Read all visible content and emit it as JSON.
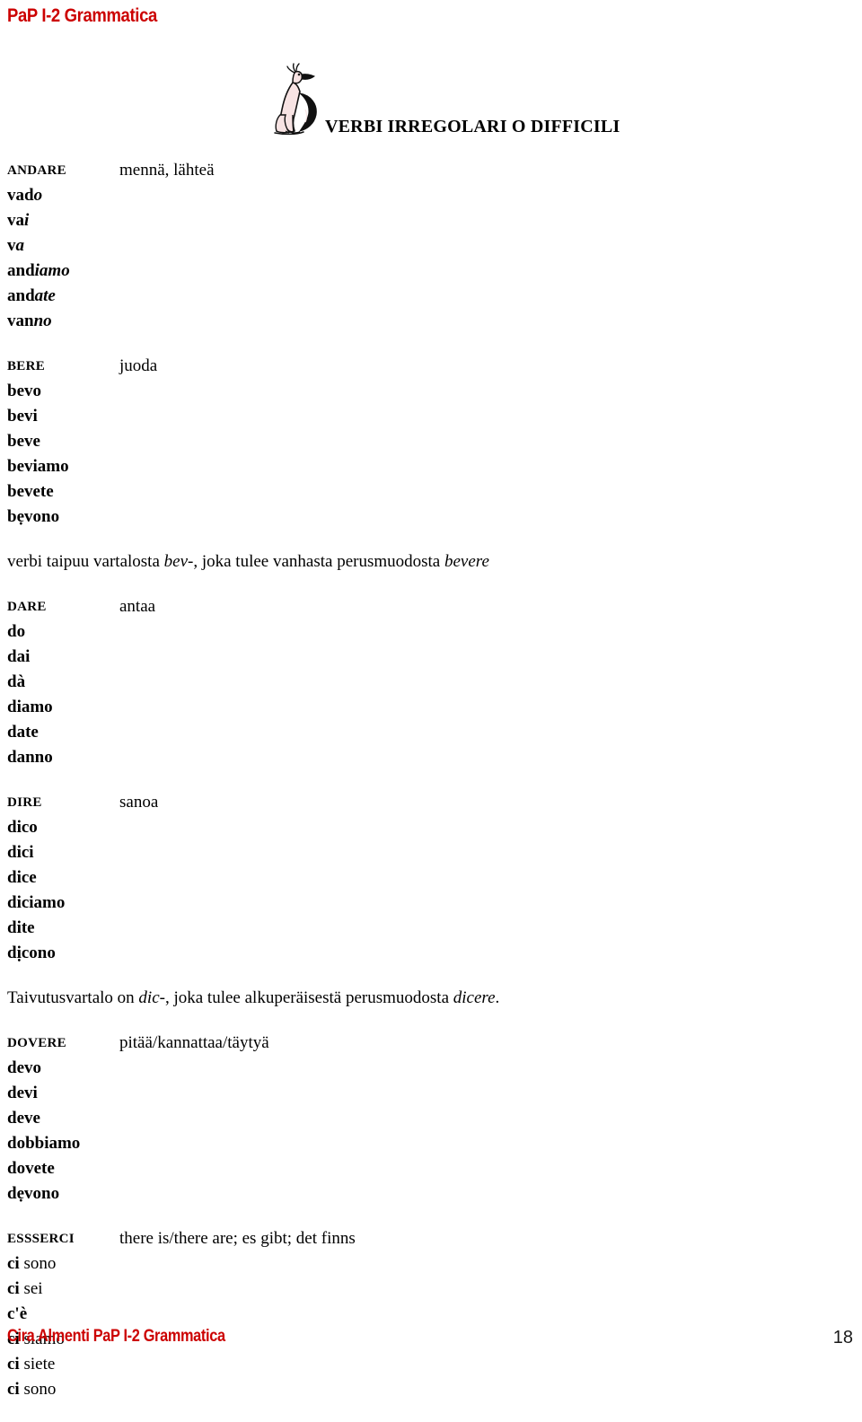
{
  "header": {
    "title": "PaP I-2 Grammatica",
    "title_color": "#CC0000"
  },
  "section": {
    "heading": "VERBI IRREGOLARI O DIFFICILI",
    "mascot_name": "sitting-dog-mascot",
    "mascot_body_color": "#F7E3E3",
    "mascot_outline_color": "#000000"
  },
  "verbs": [
    {
      "infinitive": "ANDARE",
      "translation": "mennä, lähteä",
      "forms": [
        {
          "stem": "vad",
          "ending": "o"
        },
        {
          "stem": "va",
          "ending": "i"
        },
        {
          "stem": "v",
          "ending": "a"
        },
        {
          "stem": "and",
          "ending": "iamo"
        },
        {
          "stem": "and",
          "ending": "ate"
        },
        {
          "stem": "van",
          "ending": "no"
        }
      ]
    },
    {
      "infinitive": "BERE",
      "translation": "juoda",
      "forms": [
        {
          "stem": "bevo",
          "ending": ""
        },
        {
          "stem": "bevi",
          "ending": ""
        },
        {
          "stem": "beve",
          "ending": ""
        },
        {
          "stem": "beviamo",
          "ending": ""
        },
        {
          "stem": "bevete",
          "ending": ""
        },
        {
          "stem": "bẹvono",
          "ending": ""
        }
      ],
      "note_prefix": "verbi taipuu vartalosta ",
      "note_italic1": "bev-",
      "note_middle": ", joka tulee vanhasta perusmuodosta ",
      "note_italic2": "bevere",
      "note_suffix": ""
    },
    {
      "infinitive": "DARE",
      "translation": "antaa",
      "forms": [
        {
          "stem": "do",
          "ending": ""
        },
        {
          "stem": "dai",
          "ending": ""
        },
        {
          "stem": "dà",
          "ending": ""
        },
        {
          "stem": "diamo",
          "ending": ""
        },
        {
          "stem": "date",
          "ending": ""
        },
        {
          "stem": "danno",
          "ending": ""
        }
      ]
    },
    {
      "infinitive": "DIRE",
      "translation": "sanoa",
      "forms": [
        {
          "stem": "dico",
          "ending": ""
        },
        {
          "stem": "dici",
          "ending": ""
        },
        {
          "stem": "dice",
          "ending": ""
        },
        {
          "stem": "diciamo",
          "ending": ""
        },
        {
          "stem": "dite",
          "ending": ""
        },
        {
          "stem": "dịcono",
          "ending": ""
        }
      ],
      "note_prefix": "Taivutusvartalo on ",
      "note_italic1": "dic-",
      "note_middle": ", joka tulee alkuperäisestä perusmuodosta ",
      "note_italic2": "dicere",
      "note_suffix": "."
    },
    {
      "infinitive": "DOVERE",
      "translation": "pitää/kannattaa/täytyä",
      "forms": [
        {
          "stem": "devo",
          "ending": ""
        },
        {
          "stem": "devi",
          "ending": ""
        },
        {
          "stem": "deve",
          "ending": ""
        },
        {
          "stem": "dobbiamo",
          "ending": ""
        },
        {
          "stem": "dovete",
          "ending": ""
        },
        {
          "stem": "dẹvono",
          "ending": ""
        }
      ]
    },
    {
      "infinitive": "ESSSERCI",
      "translation": "there is/there are; es gibt; det finns",
      "forms": [
        {
          "stem": "ci",
          "plain": " sono"
        },
        {
          "stem": "ci",
          "plain": " sei"
        },
        {
          "stem": "c'è",
          "plain": ""
        },
        {
          "stem": "ci",
          "plain": " siamo"
        },
        {
          "stem": "ci",
          "plain": " siete"
        },
        {
          "stem": "ci",
          "plain": " sono"
        }
      ]
    }
  ],
  "footer": {
    "text": "Cira Almenti  PaP I-2 Grammatica",
    "page": "18",
    "text_color": "#CC0000"
  }
}
